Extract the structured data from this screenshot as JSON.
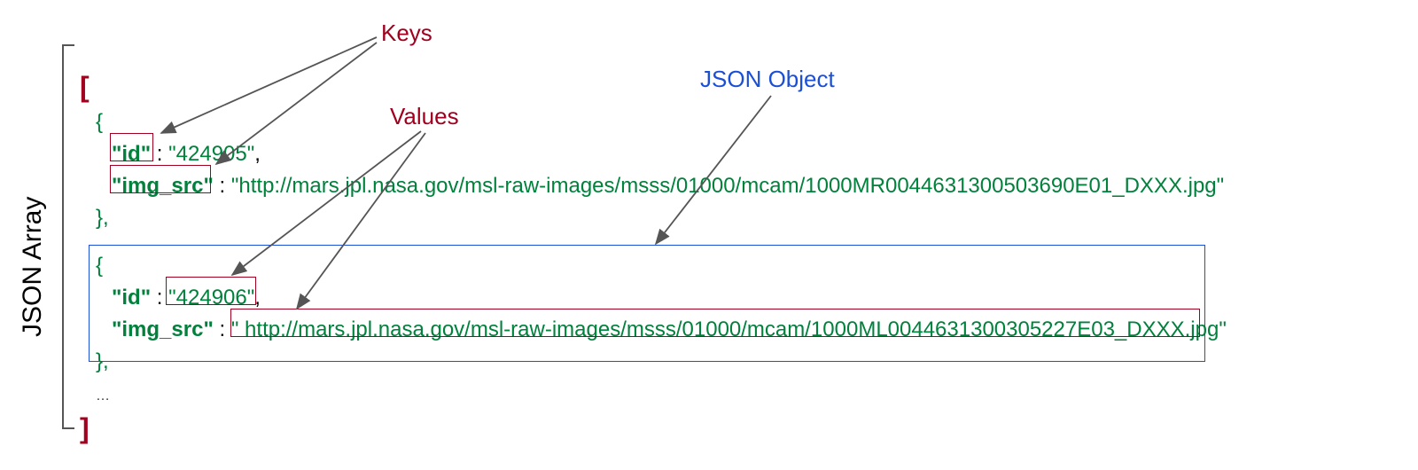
{
  "sidebar": {
    "label": "JSON Array"
  },
  "labels": {
    "keys": "Keys",
    "values": "Values",
    "json_object": "JSON Object"
  },
  "syntax": {
    "open_bracket": "[",
    "close_bracket": "]",
    "brace_open": "{",
    "brace_close_comma": "},",
    "ellipsis": "…",
    "colon_space": " : ",
    "comma": ",",
    "quote": "\""
  },
  "objects": [
    {
      "fields": [
        {
          "key": "id",
          "value": "424905"
        },
        {
          "key": "img_src",
          "value": "http://mars.jpl.nasa.gov/msl-raw-images/msss/01000/mcam/1000MR0044631300503690E01_DXXX.jpg"
        }
      ]
    },
    {
      "fields": [
        {
          "key": "id",
          "value": "424906"
        },
        {
          "key": "img_src",
          "value": " http://mars.jpl.nasa.gov/msl-raw-images/msss/01000/mcam/1000ML0044631300305227E03_DXXX.jpg"
        }
      ]
    }
  ]
}
